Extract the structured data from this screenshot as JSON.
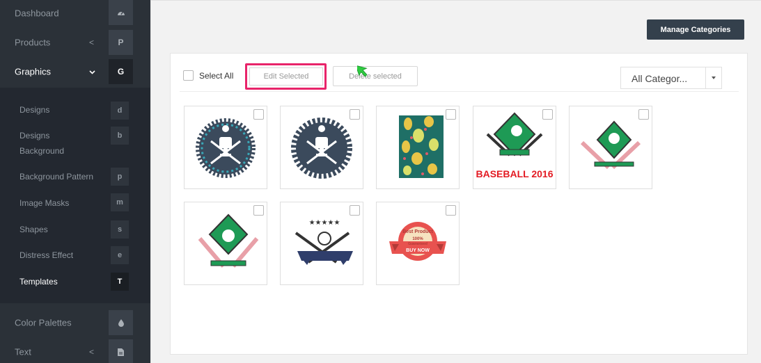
{
  "sidebar": {
    "top_items": [
      {
        "label": "Dashboard",
        "badge": "",
        "icon": "dashboard-icon"
      },
      {
        "label": "Products",
        "badge": "P",
        "chevron": "<"
      },
      {
        "label": "Graphics",
        "badge": "G",
        "chevron": "⌄"
      }
    ],
    "sub_items": [
      {
        "label": "Designs",
        "badge": "d"
      },
      {
        "label": "Designs Background",
        "line1": "Designs",
        "line2": "Background",
        "badge": "b"
      },
      {
        "label": "Background Pattern",
        "badge": "p"
      },
      {
        "label": "Image Masks",
        "badge": "m"
      },
      {
        "label": "Shapes",
        "badge": "s"
      },
      {
        "label": "Distress Effect",
        "badge": "e"
      },
      {
        "label": "Templates",
        "badge": "T"
      }
    ],
    "bottom_items": [
      {
        "label": "Color Palettes",
        "icon": "droplet-icon"
      },
      {
        "label": "Text",
        "chevron": "<",
        "icon": "file-icon"
      }
    ]
  },
  "toolbar": {
    "manage_label": "Manage Categories",
    "select_all_label": "Select All",
    "edit_label": "Edit Selected",
    "delete_label": "Delete selected",
    "category_value": "All Categor..."
  },
  "thumbnails": {
    "t6": {
      "text": "BASEBALL 2016"
    },
    "t9": {
      "line1": "Best Product",
      "line2": "100%",
      "line3": "Guaranteed",
      "line4": "BUY NOW"
    }
  },
  "colors": {
    "sidebar_bg": "#2b3138",
    "highlight": "#e8246a",
    "manage_btn": "#34404c",
    "diamond_green": "#1e9a55",
    "navy_badge": "#3b4a5c",
    "red_text": "#e31b23"
  }
}
